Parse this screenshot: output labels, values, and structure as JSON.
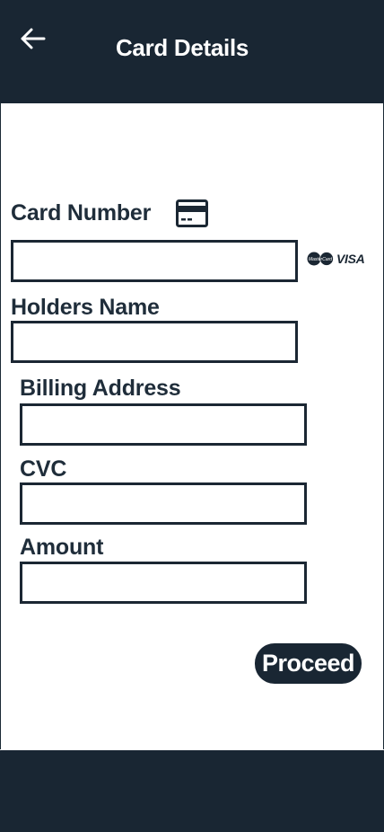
{
  "header": {
    "title": "Card Details",
    "back_icon": "arrow-left-icon"
  },
  "form": {
    "card_number": {
      "label": "Card Number",
      "value": "",
      "icon": "credit-card-icon"
    },
    "card_brands": {
      "mastercard": "MasterCard",
      "visa": "VISA"
    },
    "holders_name": {
      "label": "Holders Name",
      "value": ""
    },
    "billing_address": {
      "label": "Billing Address",
      "value": ""
    },
    "cvc": {
      "label": "CVC",
      "value": ""
    },
    "amount": {
      "label": "Amount",
      "value": ""
    }
  },
  "actions": {
    "proceed_label": "Proceed"
  },
  "colors": {
    "primary": "#192633",
    "text": "#1f2d3a",
    "background": "#ffffff"
  }
}
